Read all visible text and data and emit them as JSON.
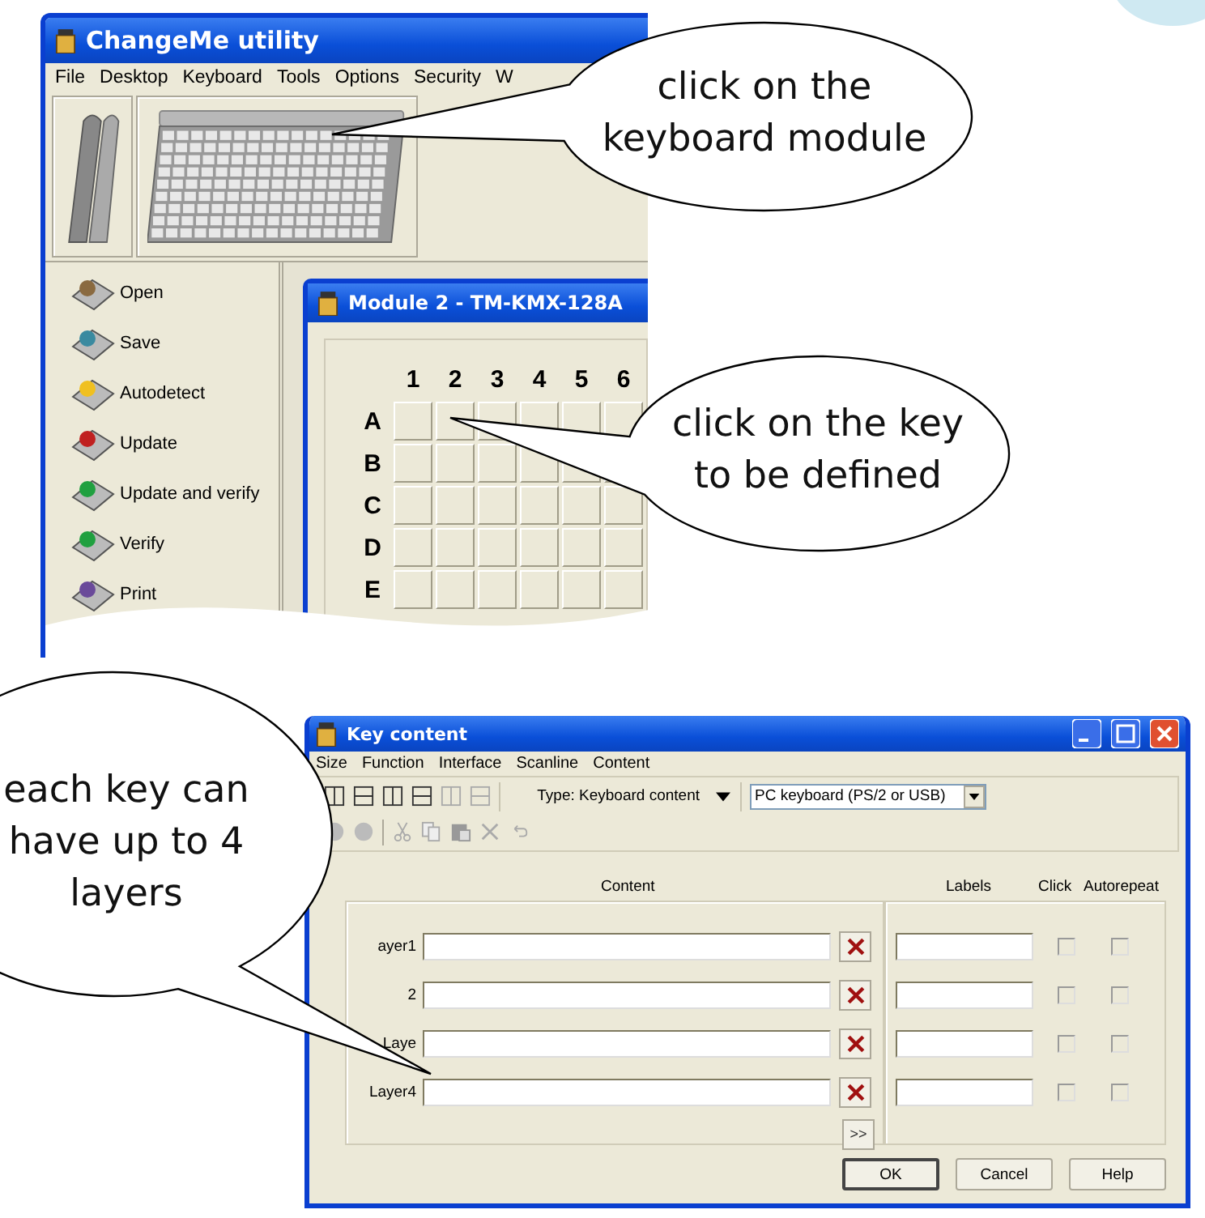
{
  "main_window": {
    "title": "ChangeMe utility",
    "menu": [
      "File",
      "Desktop",
      "Keyboard",
      "Tools",
      "Options",
      "Security",
      "W"
    ],
    "actions": [
      "Open",
      "Save",
      "Autodetect",
      "Update",
      "Update and verify",
      "Verify",
      "Print"
    ],
    "module_window": {
      "title": "Module 2 - TM-KMX-128A",
      "columns": [
        "1",
        "2",
        "3",
        "4",
        "5",
        "6"
      ],
      "rows": [
        "A",
        "B",
        "C",
        "D",
        "E"
      ]
    }
  },
  "key_window": {
    "title": "Key content",
    "menu": [
      "Size",
      "Function",
      "Interface",
      "Scanline",
      "Content"
    ],
    "type_dropdown": "Type: Keyboard content",
    "interface_combo": "PC keyboard (PS/2 or USB)",
    "headers": {
      "content": "Content",
      "labels": "Labels",
      "click": "Click",
      "autorepeat": "Autorepeat"
    },
    "layers": [
      {
        "label": "ayer1",
        "click": false,
        "autorepeat": false
      },
      {
        "label": "2",
        "click": false,
        "autorepeat": false
      },
      {
        "label": "Laye",
        "click": false,
        "autorepeat": false
      },
      {
        "label": "Layer4",
        "click": false,
        "autorepeat": false
      }
    ],
    "more_button": ">>",
    "buttons": [
      "OK",
      "Cancel",
      "Help"
    ]
  },
  "callouts": [
    "click on the keyboard module",
    "click on the key to be defined",
    "each key can have up to 4 layers"
  ]
}
